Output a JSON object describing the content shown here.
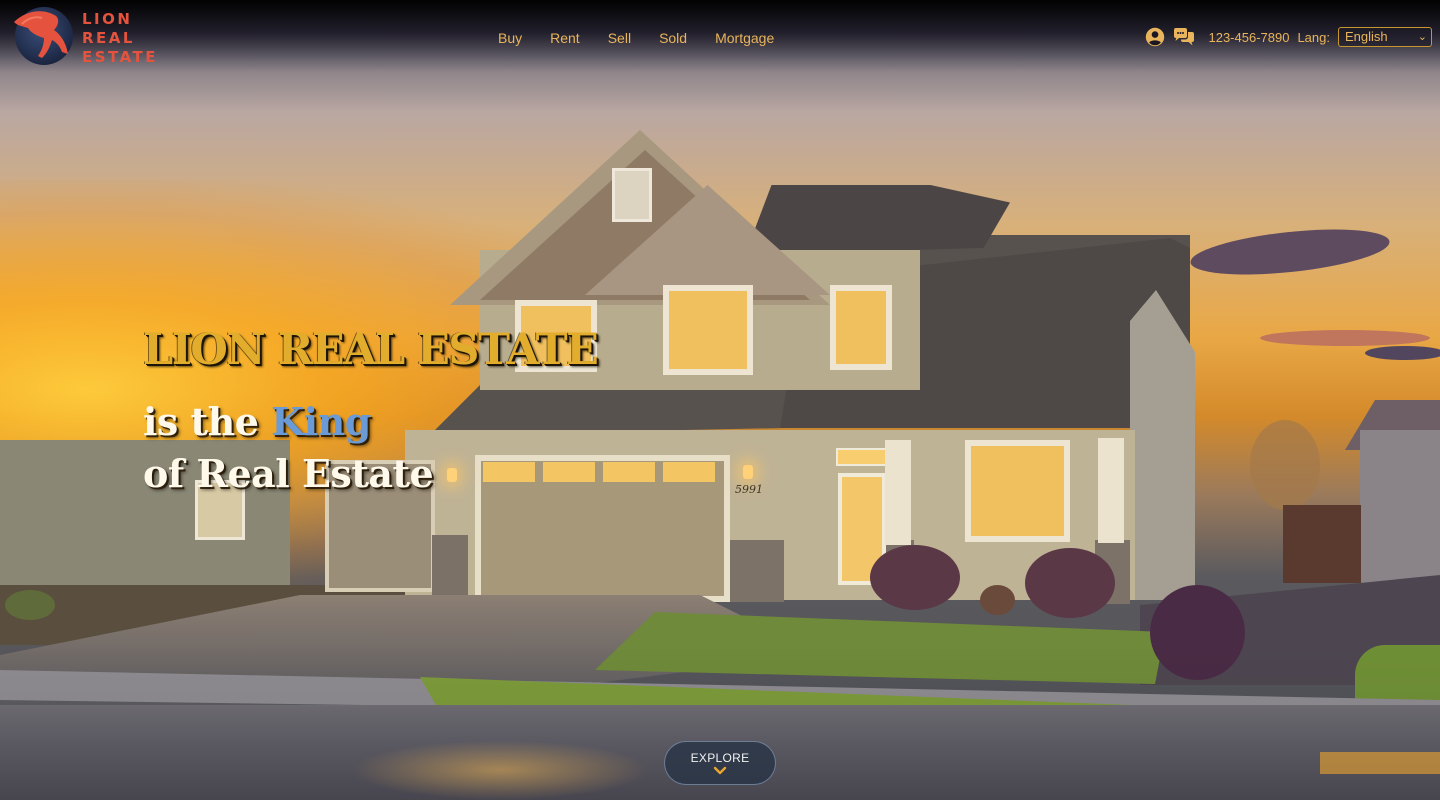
{
  "brand": {
    "logo_lines": [
      "LION",
      "REAL",
      "ESTATE"
    ],
    "logo_color": "#e5533e"
  },
  "nav": {
    "items": [
      {
        "label": "Buy"
      },
      {
        "label": "Rent"
      },
      {
        "label": "Sell"
      },
      {
        "label": "Sold"
      },
      {
        "label": "Mortgage"
      }
    ],
    "link_color": "#e9b45b"
  },
  "utilities": {
    "user_icon": "user-circle-icon",
    "chat_icon": "chat-bubbles-icon",
    "phone": "123-456-7890",
    "lang_label": "Lang:",
    "lang_selected": "English"
  },
  "hero": {
    "title": "LION REAL ESTATE",
    "subtitle_prefix": "is the ",
    "subtitle_accent": "King",
    "subtitle_line2": "of Real Estate",
    "address_sign": "5991",
    "title_color": "#e2ad2c",
    "accent_color": "#6a9bd6"
  },
  "explore": {
    "label": "EXPLORE",
    "icon": "chevron-down-icon"
  }
}
